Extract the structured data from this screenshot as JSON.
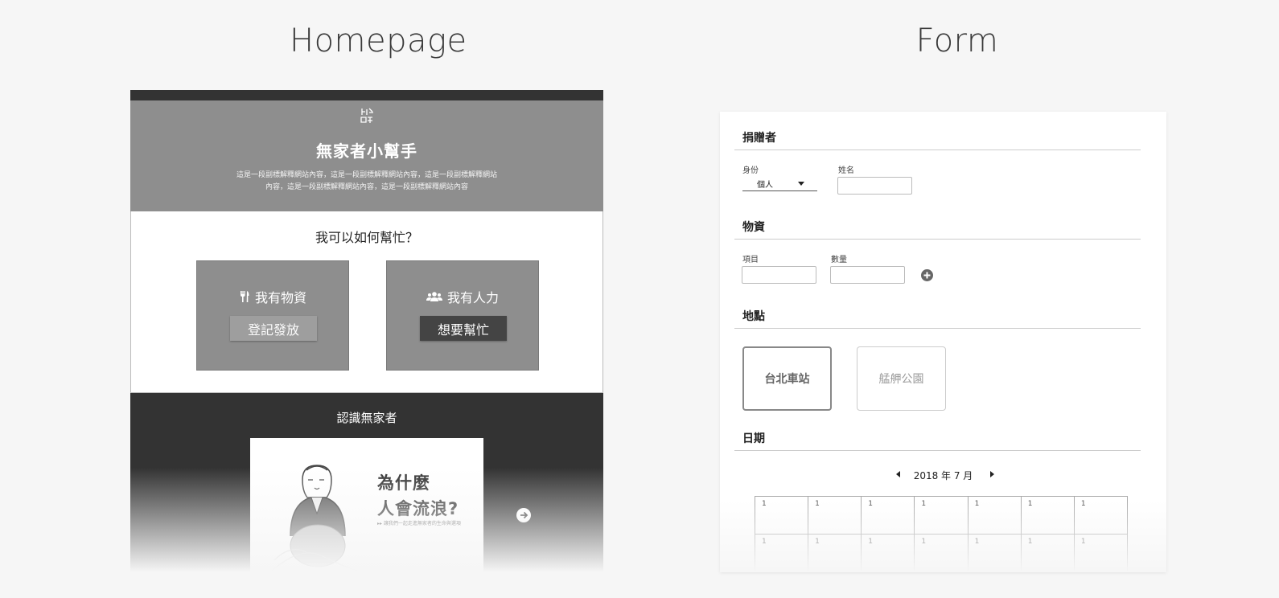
{
  "labels": {
    "homepage": "Homepage",
    "form": "Form"
  },
  "homepage": {
    "hero": {
      "title": "無家者小幫手",
      "subtitle": "這是一段副標解釋網站內容，這是一段副標解釋網站內容，這是一段副標解釋網站內容，這是一段副標解釋網站內容，這是一段副標解釋網站內容"
    },
    "help": {
      "question": "我可以如何幫忙？",
      "cards": [
        {
          "title": "我有物資",
          "icon": "utensils-icon",
          "button": "登記發放"
        },
        {
          "title": "我有人力",
          "icon": "users-icon",
          "button": "想要幫忙"
        }
      ]
    },
    "know": {
      "title": "認識無家者",
      "slide": {
        "line1": "為什麼",
        "line2": "人會流浪?",
        "tagline": "▸▸ 讓我們一起走進無家者的生命與選項"
      }
    }
  },
  "form": {
    "donor": {
      "section": "捐贈者",
      "identity_label": "身份",
      "identity_value": "個人",
      "name_label": "姓名",
      "name_value": ""
    },
    "supplies": {
      "section": "物資",
      "item_label": "項目",
      "quantity_label": "數量",
      "item_value": "",
      "quantity_value": ""
    },
    "location": {
      "section": "地點",
      "options": [
        "台北車站",
        "艋舺公園"
      ],
      "selected": "台北車站"
    },
    "date": {
      "section": "日期",
      "month_label": "2018 年 7 月",
      "rows": [
        [
          "1",
          "1",
          "1",
          "1",
          "1",
          "1",
          "1"
        ],
        [
          "1",
          "1",
          "1",
          "1",
          "1",
          "1",
          "1"
        ]
      ]
    }
  }
}
